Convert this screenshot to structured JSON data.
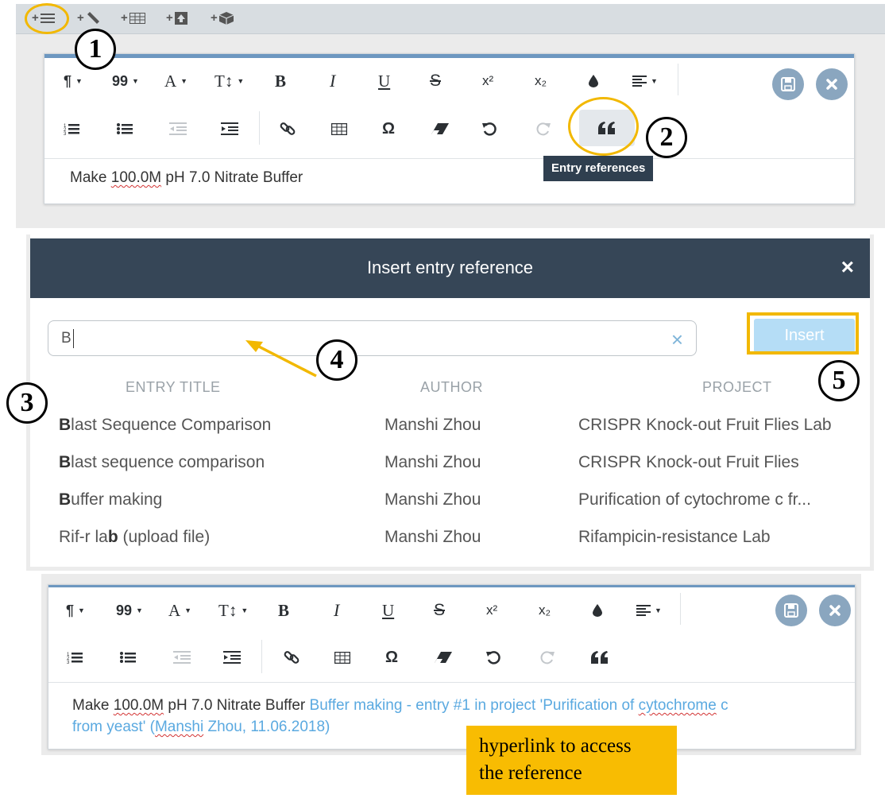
{
  "top_toolbar": {
    "add_buttons": [
      {
        "icon": "add-text-icon",
        "label": "+"
      },
      {
        "icon": "add-sketch-icon",
        "label": "+"
      },
      {
        "icon": "add-table-icon",
        "label": "+"
      },
      {
        "icon": "add-file-icon",
        "label": "+"
      },
      {
        "icon": "add-3d-icon",
        "label": "+"
      }
    ]
  },
  "editor": {
    "toolbar_row1": [
      "¶",
      "99",
      "A",
      "T↕",
      "B",
      "I",
      "U",
      "S",
      "x²",
      "x₂"
    ],
    "content_before": "Make ",
    "content_misspelled": "100.0M",
    "content_after": " pH 7.0 Nitrate Buffer"
  },
  "tooltip": "Entry references",
  "badges": {
    "b1": "1",
    "b2": "2",
    "b3": "3",
    "b4": "4",
    "b5": "5"
  },
  "modal": {
    "title": "Insert entry reference",
    "close": "×",
    "search_value": "B",
    "clear": "×",
    "insert_label": "Insert",
    "columns": {
      "title": "ENTRY TITLE",
      "author": "AUTHOR",
      "project": "PROJECT"
    },
    "rows": [
      {
        "title_bold": "B",
        "title_rest": "last Sequence Comparison",
        "author": "Manshi Zhou",
        "project": "CRISPR Knock-out Fruit Flies Lab"
      },
      {
        "title_bold": "B",
        "title_rest": "last sequence comparison",
        "author": "Manshi Zhou",
        "project": "CRISPR Knock-out Fruit Flies"
      },
      {
        "title_bold": "B",
        "title_rest": "uffer making",
        "author": "Manshi Zhou",
        "project": "Purification of cytochrome c fr..."
      },
      {
        "title_pre": "Rif-r la",
        "title_bold": "b",
        "title_rest": " (upload file)",
        "author": "Manshi Zhou",
        "project": "Rifampicin-resistance Lab"
      }
    ]
  },
  "result": {
    "text_before": "Make ",
    "text_misspelled": "100.0M",
    "text_after": " pH 7.0 Nitrate Buffer ",
    "link_part1": "Buffer making - entry #1 in project 'Purification of ",
    "link_misspelled1": "cytochrome",
    "link_part2": " c",
    "link_line2_a": "from yeast' (",
    "link_misspelled2": "Manshi",
    "link_line2_b": " Zhou, 11.06.2018)"
  },
  "callout": {
    "line1": "hyperlink to access",
    "line2": "the reference"
  },
  "colors": {
    "highlight": "#f2b800",
    "modal_header": "#364657",
    "link": "#5aa9e0",
    "callout": "#f8bc02"
  }
}
